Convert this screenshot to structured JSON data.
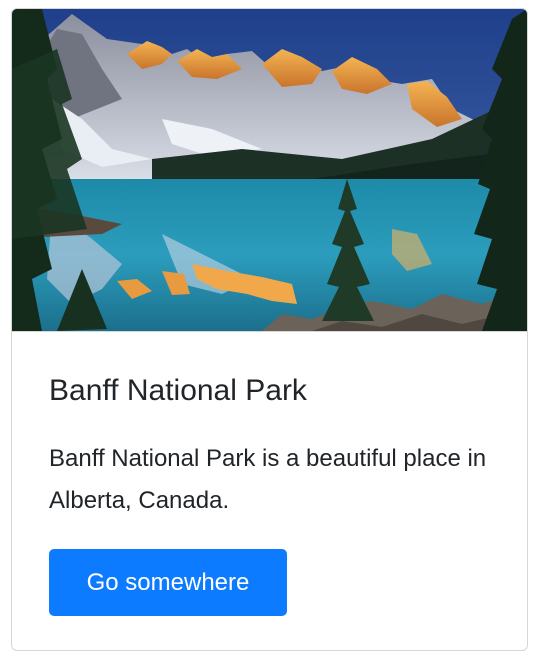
{
  "card": {
    "image_alt": "Moraine Lake with mountains reflected in turquoise water",
    "title": "Banff National Park",
    "text": "Banff National Park is a beautiful place in Alberta, Canada.",
    "button_label": "Go somewhere"
  },
  "colors": {
    "button_bg": "#0d7bff",
    "button_text": "#ffffff",
    "text": "#212529",
    "border": "#d6d6d6"
  }
}
